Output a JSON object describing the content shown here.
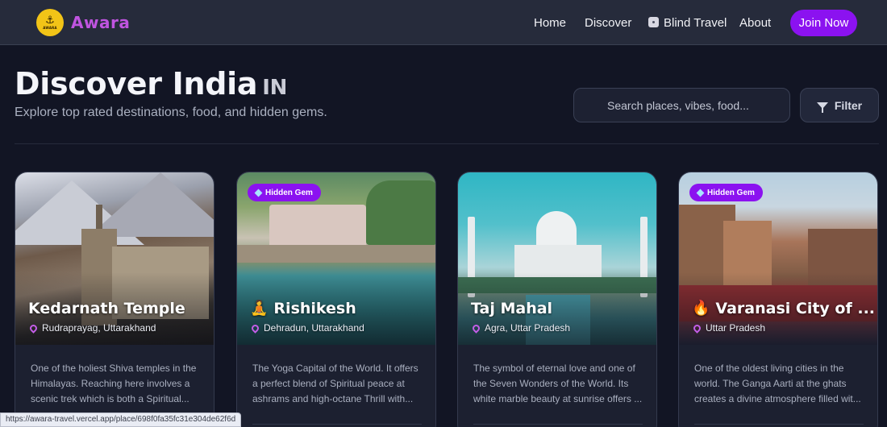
{
  "nav": {
    "brand": "Awara",
    "logo_text": "AWARA",
    "links": [
      "Home",
      "Discover",
      "Blind Travel",
      "About"
    ],
    "join_label": "Join Now"
  },
  "header": {
    "title": "Discover India",
    "flag": "IN",
    "subtitle": "Explore top rated destinations, food, and hidden gems."
  },
  "search": {
    "placeholder": "Search places, vibes, food..."
  },
  "filter_label": "Filter",
  "cards": [
    {
      "title": "Kedarnath Temple",
      "location": "Rudraprayag, Uttarakhand",
      "description": "One of the holiest Shiva temples in the Himalayas. Reaching here involves a scenic trek which is both a Spiritual...",
      "badge": "",
      "icon": ""
    },
    {
      "title": "Rishikesh",
      "location": "Dehradun, Uttarakhand",
      "description": "The Yoga Capital of the World. It offers a perfect blend of Spiritual peace at ashrams and high-octane Thrill with...",
      "badge": "Hidden Gem",
      "icon": "🧘"
    },
    {
      "title": "Taj Mahal",
      "location": "Agra, Uttar Pradesh",
      "description": "The symbol of eternal love and one of the Seven Wonders of the World. Its white marble beauty at sunrise offers ...",
      "badge": "",
      "icon": ""
    },
    {
      "title": "Varanasi City of ...",
      "location": "Uttar Pradesh",
      "description": "One of the oldest living cities in the world. The Ganga Aarti at the ghats creates a divine atmosphere filled wit...",
      "badge": "Hidden Gem",
      "icon": "🔥"
    }
  ],
  "status_url": "https://awara-travel.vercel.app/place/698f0fa35fc31e304de62f6d",
  "colors": {
    "accent": "#8b12f0",
    "brand": "#c054e0",
    "background": "#121524"
  }
}
